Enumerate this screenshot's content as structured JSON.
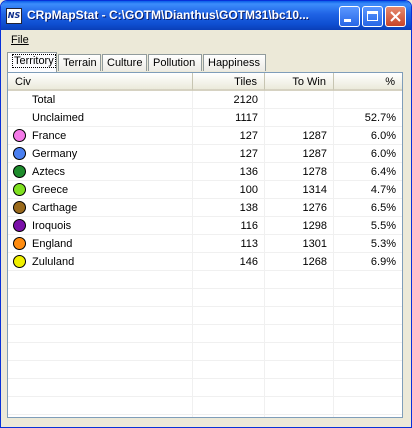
{
  "window": {
    "title": "CRpMapStat - C:\\GOTM\\Dianthus\\GOTM31\\bc10...",
    "app_icon_text": "NS"
  },
  "menu": {
    "file": "File"
  },
  "tabs": [
    "Territory",
    "Terrain",
    "Culture",
    "Pollution",
    "Happiness"
  ],
  "table": {
    "columns": [
      "Civ",
      "Tiles",
      "To Win",
      "%"
    ],
    "rows": [
      {
        "civ": "Total",
        "tiles": "2120",
        "to_win": "",
        "pct": "",
        "color": ""
      },
      {
        "civ": "Unclaimed",
        "tiles": "1117",
        "to_win": "",
        "pct": "52.7%",
        "color": ""
      },
      {
        "civ": "France",
        "tiles": "127",
        "to_win": "1287",
        "pct": "6.0%",
        "color": "#f47ae8"
      },
      {
        "civ": "Germany",
        "tiles": "127",
        "to_win": "1287",
        "pct": "6.0%",
        "color": "#4a7ff0"
      },
      {
        "civ": "Aztecs",
        "tiles": "136",
        "to_win": "1278",
        "pct": "6.4%",
        "color": "#1e8c2c"
      },
      {
        "civ": "Greece",
        "tiles": "100",
        "to_win": "1314",
        "pct": "4.7%",
        "color": "#7fe020"
      },
      {
        "civ": "Carthage",
        "tiles": "138",
        "to_win": "1276",
        "pct": "6.5%",
        "color": "#9a6a1c"
      },
      {
        "civ": "Iroquois",
        "tiles": "116",
        "to_win": "1298",
        "pct": "5.5%",
        "color": "#7a10a8"
      },
      {
        "civ": "England",
        "tiles": "113",
        "to_win": "1301",
        "pct": "5.3%",
        "color": "#ff8c10"
      },
      {
        "civ": "Zululand",
        "tiles": "146",
        "to_win": "1268",
        "pct": "6.9%",
        "color": "#f0f000"
      }
    ]
  }
}
